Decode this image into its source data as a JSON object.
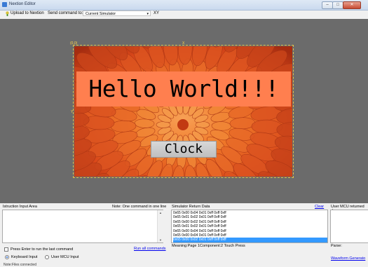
{
  "window": {
    "title": "Nextion Editor"
  },
  "toolbar": {
    "upload_label": "Upload to Nextion",
    "send_label": "Send command to:",
    "send_target": "Current Simulator",
    "xy_label": "XY"
  },
  "canvas": {
    "origin_label": "(0,0)",
    "x_label": "X",
    "y_label": "Y",
    "hello_text": "Hello World!!!",
    "clock_button": "Clock",
    "background_colors": {
      "flower": "#e0561e",
      "text_box": "#ff7f4f"
    }
  },
  "instruction": {
    "header": "Istruction Input Area",
    "note": "Note: One command in one line",
    "enter_checkbox_label": "Press Enter to run the last command",
    "run_all_label": "Run all commands"
  },
  "simulator": {
    "header": "Simulator Return Data",
    "clear_label": "Clear",
    "lines": [
      "0x65 0x00 0x04 0x01 0xff 0xff 0xff",
      "0x65 0x01 0x02 0x01 0xff 0xff 0xff",
      "0x65 0x00 0x02 0x01 0xff 0xff 0xff",
      "0x65 0x01 0x02 0x01 0xff 0xff 0xff",
      "0x65 0x00 0x04 0x01 0xff 0xff 0xff",
      "0x65 0x00 0x04 0x01 0xff 0xff 0xff",
      "0x65 0x00 0x02 0x01 0xff 0xff 0xff"
    ],
    "selected_index": 6,
    "meaning": "Meaning:Page 1Component:2 Touch Press"
  },
  "mcu": {
    "header": "User MCU returned da",
    "parse_label": "Parse:",
    "waveform_label": "Waveform Generato"
  },
  "input_mode": {
    "keyboard_label": "Keyboard Input",
    "mcu_label": "User MCU Input",
    "selected": "keyboard"
  },
  "status": {
    "text": "Note:Files connected"
  },
  "icons": {
    "app": "app-icon",
    "upload": "upload-icon",
    "dropdown": "chevron-down-icon",
    "minimize": "minimize-icon",
    "maximize": "maximize-icon",
    "close": "close-icon"
  }
}
